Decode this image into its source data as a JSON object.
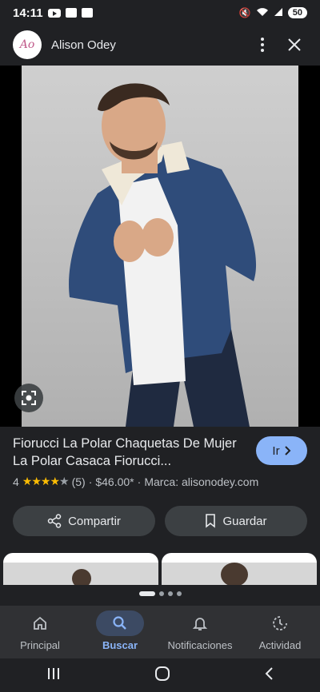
{
  "status_bar": {
    "time": "14:11",
    "battery": "50"
  },
  "header": {
    "site_name": "Alison Odey",
    "logo_text": "Ao"
  },
  "product": {
    "title": "Fiorucci La Polar Chaquetas De Mujer La Polar Casaca Fiorucci...",
    "rating": "4",
    "stars_filled": 4,
    "stars_total": 5,
    "review_count": "(5)",
    "price": "$46.00*",
    "brand": "Marca: alisonodey.com",
    "go_label": "Ir"
  },
  "actions": {
    "share_label": "Compartir",
    "save_label": "Guardar"
  },
  "bottom_nav": {
    "home": "Principal",
    "search": "Buscar",
    "notifications": "Notificaciones",
    "activity": "Actividad"
  },
  "colors": {
    "accent": "#8ab4f8",
    "background": "#202124",
    "star": "#fbbc04"
  }
}
